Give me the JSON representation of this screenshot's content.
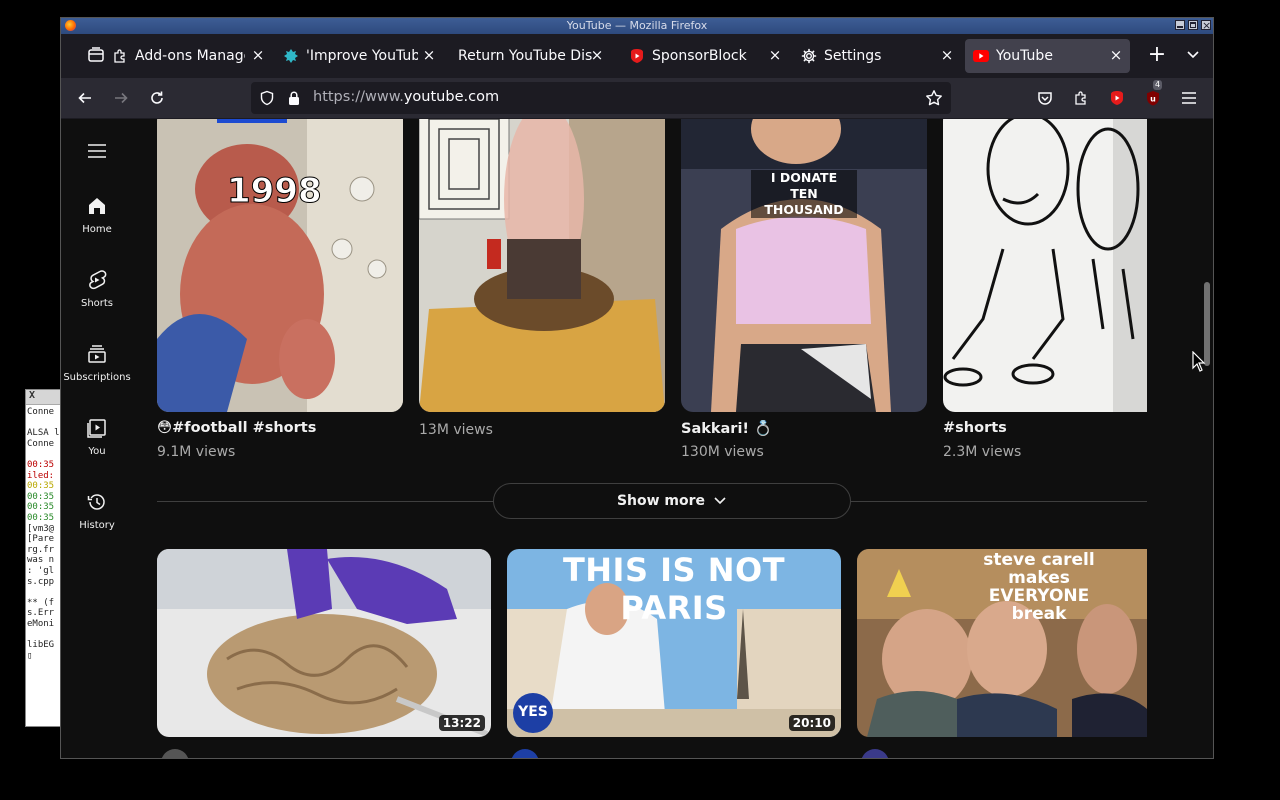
{
  "window": {
    "title": "YouTube — Mozilla Firefox"
  },
  "terminal": {
    "lines": [
      {
        "text": "Conne",
        "c": ""
      },
      {
        "text": "",
        "c": ""
      },
      {
        "text": "ALSA l",
        "c": ""
      },
      {
        "text": "Conne",
        "c": ""
      },
      {
        "text": "",
        "c": ""
      },
      {
        "text": "00:35",
        "c": "r"
      },
      {
        "text": "iled:",
        "c": "r"
      },
      {
        "text": "00:35",
        "c": "y"
      },
      {
        "text": "00:35",
        "c": "g"
      },
      {
        "text": "00:35",
        "c": "g"
      },
      {
        "text": "00:35",
        "c": "g"
      },
      {
        "text": "[vm3@",
        "c": ""
      },
      {
        "text": "[Pare",
        "c": ""
      },
      {
        "text": "rg.fr",
        "c": ""
      },
      {
        "text": "was n",
        "c": ""
      },
      {
        "text": ": 'gl",
        "c": ""
      },
      {
        "text": "s.cpp",
        "c": ""
      },
      {
        "text": "",
        "c": ""
      },
      {
        "text": "** (f",
        "c": ""
      },
      {
        "text": "s.Err",
        "c": ""
      },
      {
        "text": "eMoni",
        "c": ""
      },
      {
        "text": "",
        "c": ""
      },
      {
        "text": "libEG",
        "c": ""
      },
      {
        "text": "▯",
        "c": ""
      }
    ]
  },
  "tabs": [
    {
      "title": "Add-ons Manage",
      "icon": "puzzle-icon"
    },
    {
      "title": "'Improve YouTub",
      "icon": "improve-youtube-icon"
    },
    {
      "title": "Return YouTube Disl",
      "icon": "none"
    },
    {
      "title": "SponsorBlock",
      "icon": "youtube-icon"
    },
    {
      "title": "Settings",
      "icon": "gear-icon"
    },
    {
      "title": "YouTube",
      "icon": "youtube-icon"
    }
  ],
  "navbar": {
    "url_host": "https://www.",
    "url_domain": "youtube.com",
    "extension_badge": "4"
  },
  "sidebar": {
    "items": [
      {
        "label": "Home",
        "icon": "home-icon"
      },
      {
        "label": "Shorts",
        "icon": "shorts-icon"
      },
      {
        "label": "Subscriptions",
        "icon": "subscriptions-icon"
      },
      {
        "label": "You",
        "icon": "you-icon"
      },
      {
        "label": "History",
        "icon": "history-icon"
      }
    ]
  },
  "shorts": [
    {
      "overlay": "1998",
      "title": "😳#football #shorts",
      "views": "9.1M views"
    },
    {
      "overlay": "",
      "title": "",
      "views": "13M views"
    },
    {
      "overlay": "I DONATE\nTEN THOUSAND",
      "title": "Sakkari! 💍",
      "views": "130M views"
    },
    {
      "overlay": "",
      "title": "#shorts",
      "views": "2.3M views"
    }
  ],
  "show_more": {
    "label": "Show more"
  },
  "videos": [
    {
      "duration": "13:22",
      "overlay": ""
    },
    {
      "duration": "20:10",
      "overlay": "THIS IS NOT PARIS",
      "badge": "YES"
    },
    {
      "duration": "",
      "overlay": "steve carell\nmakes\nEVERYONE\nbreak"
    }
  ],
  "colors": {
    "youtube_red": "#ff0000",
    "page_bg": "#0f0f0f",
    "toolbar_bg": "#2b2a33",
    "tab_active": "#42414d"
  }
}
